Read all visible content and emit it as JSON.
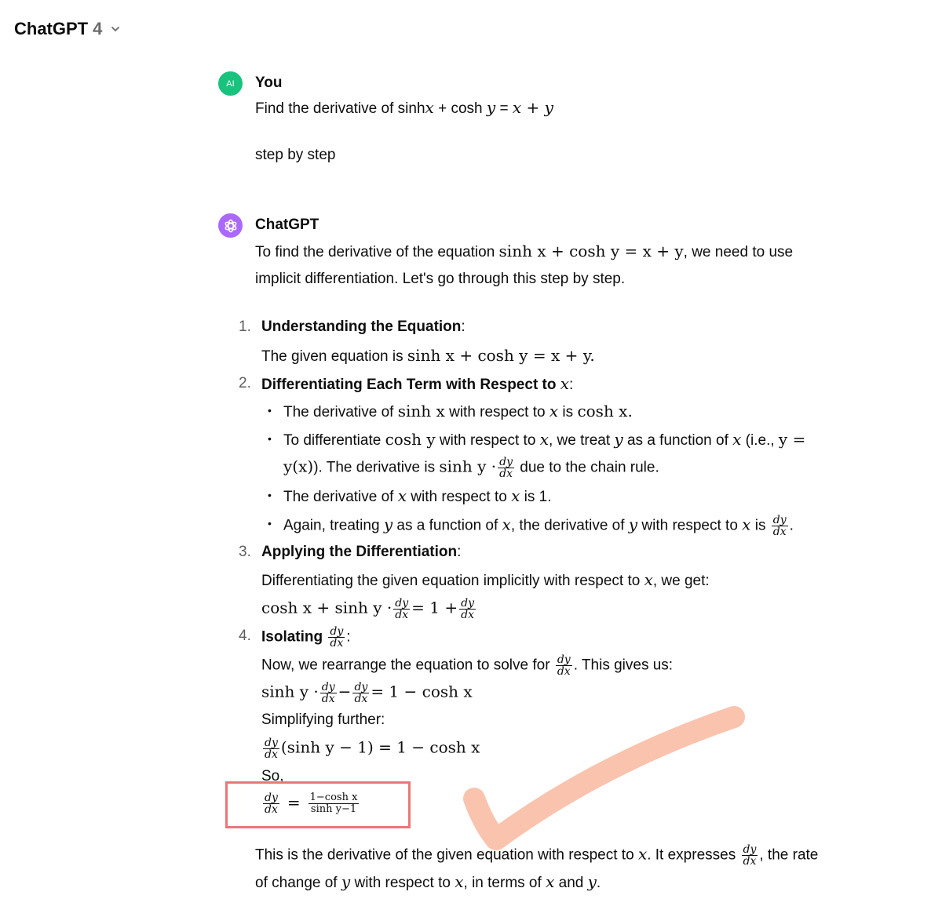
{
  "header": {
    "model_name": "ChatGPT",
    "model_version": "4"
  },
  "user": {
    "avatar_initials": "AI",
    "name": "You",
    "prompt_text": "Find the derivative of sinh",
    "prompt_x": "x",
    "prompt_plus": " + cosh ",
    "prompt_y": "y",
    "prompt_eq": " = ",
    "prompt_rhs": "x + y",
    "prompt_line2": "step by step"
  },
  "assistant": {
    "name": "ChatGPT",
    "intro_a": "To find the derivative of the equation ",
    "intro_eq": "sinh x + cosh y = x + y",
    "intro_b": ", we need to use",
    "intro_line2": "implicit differentiation. Let's go through this step by step.",
    "steps": [
      {
        "num": "1.",
        "title": "Understanding the Equation",
        "body_a": "The given equation is ",
        "body_eq": "sinh x + cosh y = x + y."
      },
      {
        "num": "2.",
        "title": "Differentiating Each Term with Respect to ",
        "title_var": "x"
      },
      {
        "num": "3.",
        "title": "Applying the Differentiation",
        "body_a": "Differentiating the given equation implicitly with respect to ",
        "body_var": "x",
        "body_b": ", we get:"
      },
      {
        "num": "4.",
        "title": "Isolating "
      }
    ],
    "bullets": {
      "b1_a": "The derivative of ",
      "b1_m1": "sinh x",
      "b1_b": " with respect to ",
      "b1_v": "x",
      "b1_c": " is ",
      "b1_m2": "cosh x.",
      "b2_a": "To differentiate ",
      "b2_m1": "cosh y",
      "b2_b": " with respect to ",
      "b2_v1": "x",
      "b2_c": ", we treat ",
      "b2_v2": "y",
      "b2_d": " as a function of ",
      "b2_v3": "x",
      "b2_e": " (i.e., ",
      "b2_m2": "y =",
      "b2_line2_m": "y(x)",
      "b2_line2_a": "). The derivative is ",
      "b2_line2_m2": "sinh y ·",
      "b2_line2_b": " due to the chain rule.",
      "b3_a": "The derivative of ",
      "b3_v1": "x",
      "b3_b": " with respect to ",
      "b3_v2": "x",
      "b3_c": " is 1.",
      "b4_a": "Again, treating ",
      "b4_v1": "y",
      "b4_b": " as a function of ",
      "b4_v2": "x",
      "b4_c": ", the derivative of ",
      "b4_v3": "y",
      "b4_d": " with respect to ",
      "b4_v4": "x",
      "b4_e": " is "
    },
    "frac_dy": "dy",
    "frac_dx": "dx",
    "eq3_a": "cosh x + sinh y ·",
    "eq3_b": "= 1 +",
    "step4_body_a": "Now, we rearrange the equation to solve for ",
    "step4_body_b": ". This gives us:",
    "eq4_a": "sinh y ·",
    "eq4_b": "−",
    "eq4_c": "= 1 − cosh x",
    "simplifying": "Simplifying further:",
    "eq5_b": "(sinh y − 1) = 1 − cosh x",
    "so": "So,",
    "eq6_eq": "=",
    "eq6_num": "1−cosh x",
    "eq6_den": "sinh y−1",
    "concl_a": "This is the derivative of the given equation with respect to ",
    "concl_v": "x",
    "concl_b": ". It expresses ",
    "concl_c": ", the rate",
    "concl2_a": "of change of ",
    "concl2_v1": "y",
    "concl2_b": " with respect to ",
    "concl2_v2": "x",
    "concl2_c": ", in terms of ",
    "concl2_v3": "x",
    "concl2_d": " and ",
    "concl2_v4": "y",
    "concl2_e": "."
  },
  "colors": {
    "highlight_border": "#e9777a",
    "checkmark": "#f9b8a0",
    "user_avatar": "#19c37d",
    "bot_avatar": "#ab68ff"
  }
}
